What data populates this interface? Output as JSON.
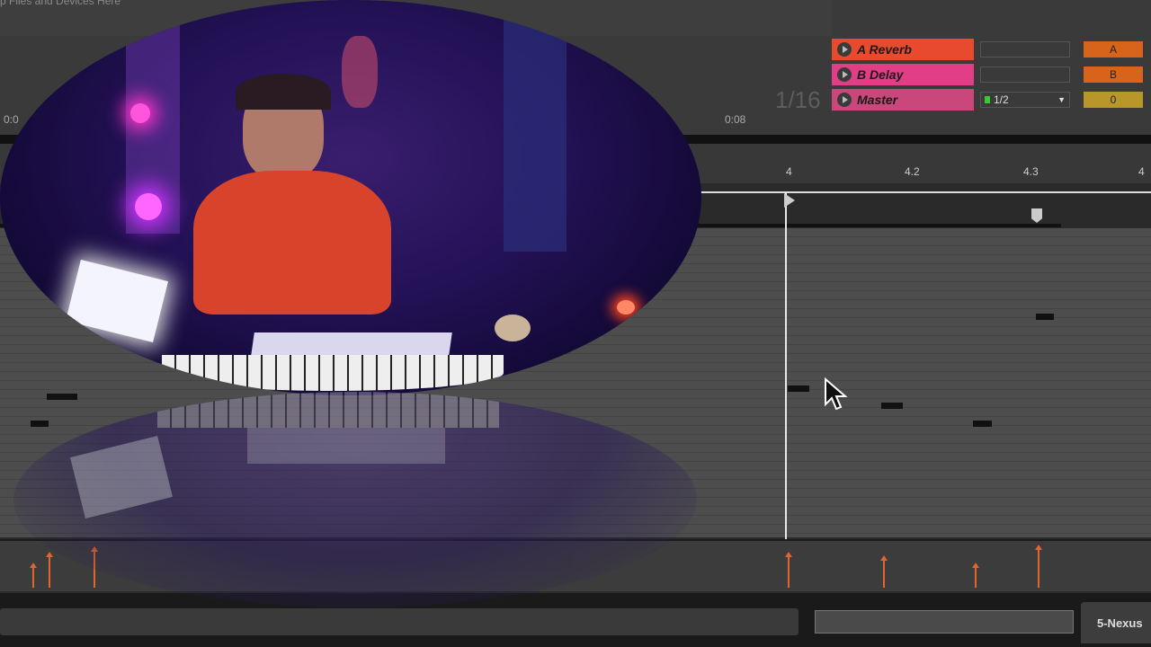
{
  "header": {
    "hint_text": "p Files and Devices Here"
  },
  "tracks": [
    {
      "name": "A Reverb",
      "color": "#e84a2e",
      "input": "",
      "letter": "A",
      "letter_color": "#d8641b"
    },
    {
      "name": "B Delay",
      "color": "#e23d87",
      "input": "",
      "letter": "B",
      "letter_color": "#d8641b"
    },
    {
      "name": "Master",
      "color": "#c9477a",
      "input": "1/2",
      "letter": "0",
      "letter_color": "#b8962a"
    }
  ],
  "grid": {
    "quantize": "1/16"
  },
  "time_ruler": {
    "start": "0:0",
    "mark": "0:08"
  },
  "bar_ruler": {
    "labels": [
      "4",
      "4.2",
      "4.3",
      "4"
    ]
  },
  "footer": {
    "clip_name": "5-Nexus"
  },
  "colors": {
    "velocity": "#e0662f",
    "background": "#2a2a2a"
  },
  "icons": [
    "play-icon",
    "mouse-cursor-icon",
    "loop-start-flag-icon",
    "loop-end-marker-icon"
  ]
}
